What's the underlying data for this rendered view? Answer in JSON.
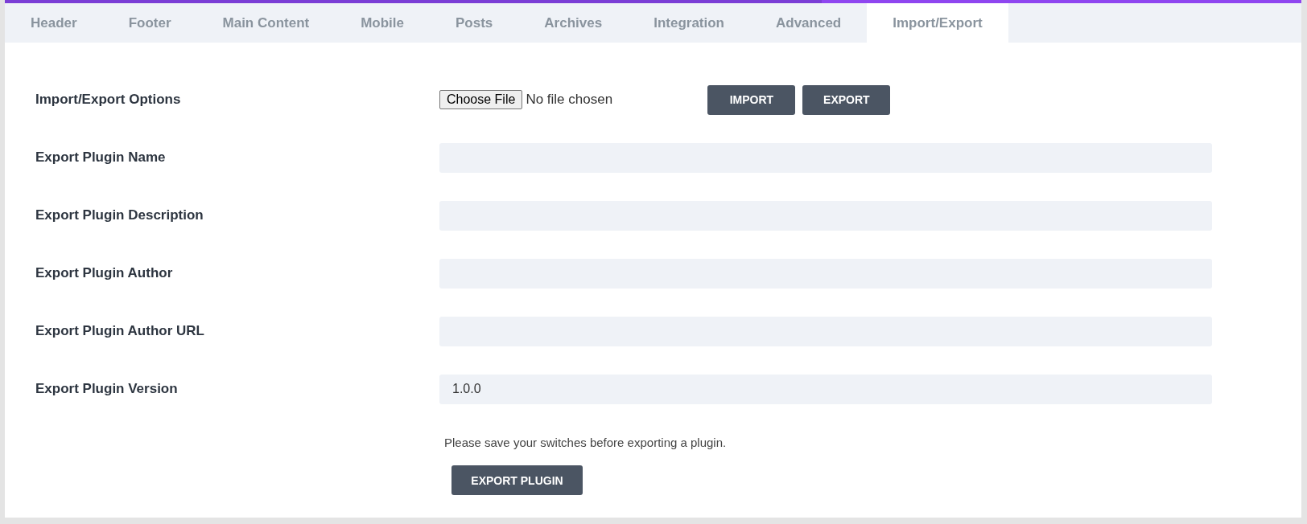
{
  "tabs": [
    {
      "label": "Header",
      "selected": false
    },
    {
      "label": "Footer",
      "selected": false
    },
    {
      "label": "Main Content",
      "selected": false
    },
    {
      "label": "Mobile",
      "selected": false
    },
    {
      "label": "Posts",
      "selected": false
    },
    {
      "label": "Archives",
      "selected": false
    },
    {
      "label": "Integration",
      "selected": false
    },
    {
      "label": "Advanced",
      "selected": false
    },
    {
      "label": "Import/Export",
      "selected": true
    }
  ],
  "rows": [
    {
      "kind": "file",
      "label": "Import/Export Options",
      "file_button": "Choose File",
      "file_status": "No file chosen",
      "buttons": [
        "IMPORT",
        "EXPORT"
      ]
    },
    {
      "kind": "text",
      "label": "Export Plugin Name"
    },
    {
      "kind": "text",
      "label": "Export Plugin Description"
    },
    {
      "kind": "text",
      "label": "Export Plugin Author"
    },
    {
      "kind": "text",
      "label": "Export Plugin Author URL"
    },
    {
      "kind": "text",
      "label": "Export Plugin Version",
      "value": "1.0.0"
    }
  ],
  "note": "Please save your switches before exporting a plugin.",
  "export_button": "EXPORT PLUGIN"
}
